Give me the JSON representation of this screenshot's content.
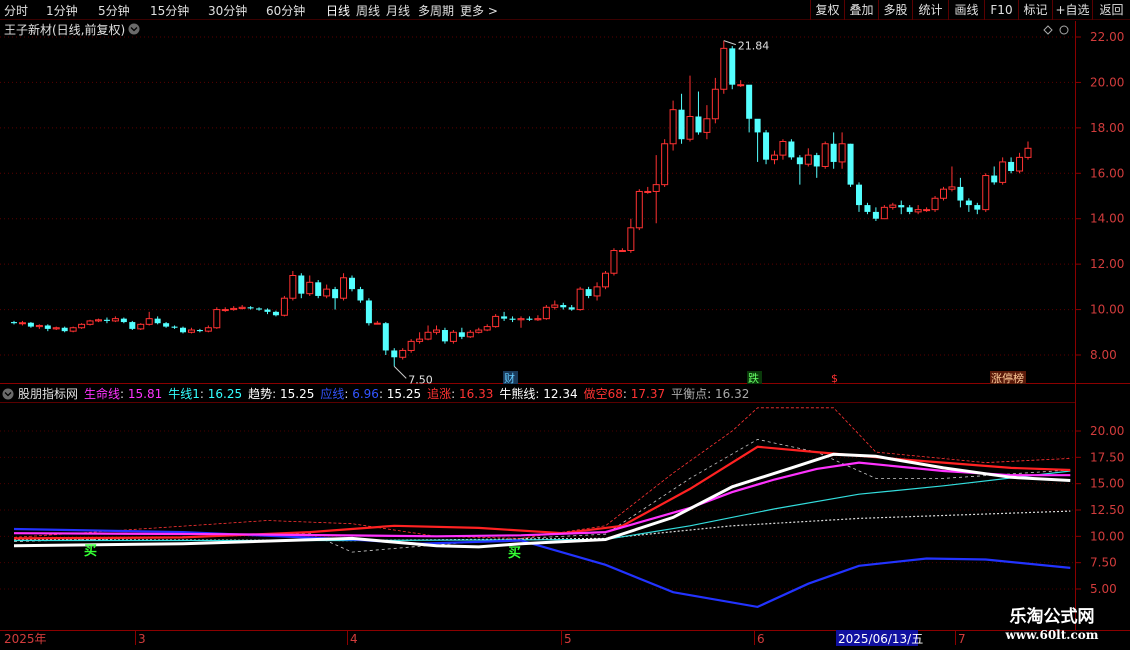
{
  "toolbar": {
    "periods": [
      "分时",
      "1分钟",
      "5分钟",
      "15分钟",
      "30分钟",
      "60分钟",
      "日线",
      "周线",
      "月线",
      "多周期",
      "更多"
    ],
    "active_period": "日线",
    "right_buttons": [
      "复权",
      "叠加",
      "多股",
      "统计",
      "画线",
      "F10",
      "+自选",
      "返回"
    ]
  },
  "main_panel": {
    "title": "王子新材(日线,前复权)",
    "high_label": "21.84",
    "low_label": "7.50",
    "price_axis": [
      "22.00",
      "20.00",
      "18.00",
      "16.00",
      "14.00",
      "12.00",
      "10.00",
      "8.00"
    ],
    "markers": {
      "cai": "财",
      "die": "跌",
      "dollar": "$",
      "bang": "涨停榜"
    }
  },
  "indicator_panel": {
    "name": "股朋指标网",
    "items": [
      {
        "label": "生命线",
        "value": "15.81",
        "color": "#ff33ff"
      },
      {
        "label": "牛线1",
        "value": "16.25",
        "color": "#33ffff"
      },
      {
        "label": "趋势",
        "value": "15.25",
        "color": "#ffffff"
      },
      {
        "label": "应线",
        "value": "6.96",
        "color": "#3355ff"
      },
      {
        "label": "",
        "value": "15.25",
        "color": "#ffffff"
      },
      {
        "label": "追涨",
        "value": "16.33",
        "color": "#ff3333"
      },
      {
        "label": "牛熊线",
        "value": "12.34",
        "color": "#ffffff"
      },
      {
        "label": "做空68",
        "value": "17.37",
        "color": "#ff3333"
      },
      {
        "label": "平衡点",
        "value": "16.32",
        "color": "#aaaaaa"
      }
    ],
    "axis": [
      "20.00",
      "17.50",
      "15.00",
      "12.50",
      "10.00",
      "7.50",
      "5.00"
    ],
    "signal_glyph": "买"
  },
  "time_axis": {
    "labels": [
      "2025年",
      "3",
      "4",
      "5",
      "6",
      "7"
    ],
    "cursor_date": "2025/06/13/五"
  },
  "watermark": {
    "title": "乐淘公式网",
    "url": "www.60lt.com"
  },
  "colors": {
    "up": "#ff3232",
    "down": "#54ffff",
    "grid": "#8b0000",
    "axis_text": "#d23c3c"
  },
  "chart_data": {
    "type": "candlestick",
    "y_range": [
      7.0,
      22.5
    ],
    "candles": [
      [
        9.45,
        9.4,
        9.5,
        9.35
      ],
      [
        9.4,
        9.42,
        9.5,
        9.3
      ],
      [
        9.42,
        9.25,
        9.45,
        9.2
      ],
      [
        9.25,
        9.3,
        9.35,
        9.15
      ],
      [
        9.3,
        9.15,
        9.35,
        9.05
      ],
      [
        9.15,
        9.2,
        9.25,
        9.1
      ],
      [
        9.2,
        9.05,
        9.25,
        9.0
      ],
      [
        9.05,
        9.2,
        9.25,
        9.0
      ],
      [
        9.2,
        9.35,
        9.4,
        9.15
      ],
      [
        9.35,
        9.5,
        9.55,
        9.3
      ],
      [
        9.5,
        9.55,
        9.6,
        9.45
      ],
      [
        9.55,
        9.5,
        9.65,
        9.4
      ],
      [
        9.5,
        9.6,
        9.7,
        9.45
      ],
      [
        9.6,
        9.45,
        9.65,
        9.4
      ],
      [
        9.45,
        9.15,
        9.5,
        9.1
      ],
      [
        9.15,
        9.35,
        9.4,
        9.1
      ],
      [
        9.35,
        9.6,
        9.9,
        9.3
      ],
      [
        9.6,
        9.4,
        9.7,
        9.35
      ],
      [
        9.4,
        9.25,
        9.45,
        9.2
      ],
      [
        9.25,
        9.2,
        9.3,
        9.15
      ],
      [
        9.2,
        9.0,
        9.25,
        8.95
      ],
      [
        9.0,
        9.1,
        9.2,
        8.95
      ],
      [
        9.1,
        9.05,
        9.15,
        9.0
      ],
      [
        9.05,
        9.2,
        9.3,
        9.0
      ],
      [
        9.2,
        10.0,
        10.1,
        9.15
      ],
      [
        10.0,
        10.0,
        10.1,
        9.9
      ],
      [
        10.0,
        10.05,
        10.15,
        9.95
      ],
      [
        10.05,
        10.1,
        10.2,
        10.0
      ],
      [
        10.1,
        10.05,
        10.15,
        10.0
      ],
      [
        10.05,
        10.0,
        10.1,
        9.95
      ],
      [
        10.0,
        9.9,
        10.05,
        9.8
      ],
      [
        9.9,
        9.75,
        9.95,
        9.7
      ],
      [
        9.75,
        10.5,
        10.6,
        9.7
      ],
      [
        10.5,
        11.5,
        11.7,
        10.4
      ],
      [
        11.5,
        10.7,
        11.6,
        10.5
      ],
      [
        10.7,
        11.2,
        11.5,
        10.6
      ],
      [
        11.2,
        10.6,
        11.3,
        10.5
      ],
      [
        10.6,
        10.9,
        11.1,
        10.5
      ],
      [
        10.9,
        10.5,
        11.0,
        10.0
      ],
      [
        10.5,
        11.4,
        11.6,
        10.4
      ],
      [
        11.4,
        10.9,
        11.5,
        10.8
      ],
      [
        10.9,
        10.4,
        11.0,
        10.3
      ],
      [
        10.4,
        9.4,
        10.5,
        9.3
      ],
      [
        9.4,
        9.4,
        9.5,
        9.35
      ],
      [
        9.4,
        8.2,
        9.45,
        8.0
      ],
      [
        8.2,
        7.9,
        8.3,
        7.5
      ],
      [
        7.9,
        8.2,
        8.3,
        7.8
      ],
      [
        8.2,
        8.6,
        8.7,
        8.1
      ],
      [
        8.6,
        8.7,
        9.0,
        8.5
      ],
      [
        8.7,
        9.0,
        9.3,
        8.65
      ],
      [
        9.0,
        9.1,
        9.3,
        8.9
      ],
      [
        9.1,
        8.6,
        9.2,
        8.5
      ],
      [
        8.6,
        9.0,
        9.1,
        8.5
      ],
      [
        9.0,
        8.8,
        9.2,
        8.7
      ],
      [
        8.8,
        9.0,
        9.1,
        8.75
      ],
      [
        9.0,
        9.1,
        9.2,
        8.95
      ],
      [
        9.1,
        9.25,
        9.35,
        9.05
      ],
      [
        9.25,
        9.7,
        9.8,
        9.2
      ],
      [
        9.7,
        9.6,
        9.9,
        9.5
      ],
      [
        9.6,
        9.55,
        9.7,
        9.45
      ],
      [
        9.55,
        9.6,
        9.7,
        9.2
      ],
      [
        9.6,
        9.55,
        9.7,
        9.5
      ],
      [
        9.55,
        9.6,
        9.75,
        9.5
      ],
      [
        9.6,
        10.1,
        10.2,
        9.55
      ],
      [
        10.1,
        10.2,
        10.4,
        10.0
      ],
      [
        10.2,
        10.1,
        10.3,
        10.0
      ],
      [
        10.1,
        10.0,
        10.2,
        9.95
      ],
      [
        10.0,
        10.9,
        11.0,
        9.95
      ],
      [
        10.9,
        10.6,
        11.0,
        10.5
      ],
      [
        10.6,
        11.0,
        11.2,
        10.4
      ],
      [
        11.0,
        11.6,
        11.7,
        10.9
      ],
      [
        11.6,
        12.6,
        12.7,
        11.5
      ],
      [
        12.6,
        12.6,
        12.7,
        12.55
      ],
      [
        12.6,
        13.6,
        14.0,
        12.5
      ],
      [
        13.6,
        15.2,
        15.3,
        13.5
      ],
      [
        15.2,
        15.2,
        15.4,
        15.1
      ],
      [
        15.2,
        15.5,
        16.8,
        13.8
      ],
      [
        15.5,
        17.3,
        17.5,
        15.4
      ],
      [
        17.3,
        18.8,
        19.2,
        17.0
      ],
      [
        18.8,
        17.5,
        19.5,
        17.3
      ],
      [
        17.5,
        18.5,
        20.3,
        17.4
      ],
      [
        18.5,
        17.8,
        19.6,
        17.7
      ],
      [
        17.8,
        18.4,
        19.0,
        17.5
      ],
      [
        18.4,
        19.7,
        20.2,
        18.2
      ],
      [
        19.7,
        21.5,
        21.84,
        19.5
      ],
      [
        21.5,
        19.9,
        21.6,
        19.7
      ],
      [
        19.9,
        19.9,
        20.1,
        19.8
      ],
      [
        19.9,
        18.4,
        18.7,
        17.8
      ],
      [
        18.4,
        17.8,
        18.1,
        16.5
      ],
      [
        17.8,
        16.6,
        17.9,
        16.4
      ],
      [
        16.6,
        16.8,
        17.0,
        16.4
      ],
      [
        16.8,
        17.4,
        17.5,
        16.6
      ],
      [
        17.4,
        16.7,
        17.5,
        16.6
      ],
      [
        16.7,
        16.4,
        16.8,
        15.5
      ],
      [
        16.4,
        16.8,
        17.1,
        16.3
      ],
      [
        16.8,
        16.3,
        16.9,
        15.8
      ],
      [
        16.3,
        17.3,
        17.4,
        16.2
      ],
      [
        17.3,
        16.5,
        17.8,
        16.2
      ],
      [
        16.5,
        17.3,
        17.8,
        16.2
      ],
      [
        17.3,
        15.5,
        17.3,
        15.4
      ],
      [
        15.5,
        14.6,
        15.6,
        14.3
      ],
      [
        14.6,
        14.3,
        14.7,
        14.2
      ],
      [
        14.3,
        14.0,
        14.5,
        13.9
      ],
      [
        14.0,
        14.5,
        14.6,
        14.0
      ],
      [
        14.5,
        14.6,
        14.7,
        14.4
      ],
      [
        14.6,
        14.5,
        14.8,
        14.2
      ],
      [
        14.5,
        14.3,
        14.6,
        14.2
      ],
      [
        14.3,
        14.4,
        14.6,
        14.2
      ],
      [
        14.4,
        14.4,
        14.5,
        14.3
      ],
      [
        14.4,
        14.9,
        15.0,
        14.3
      ],
      [
        14.9,
        15.3,
        15.4,
        14.8
      ],
      [
        15.3,
        15.4,
        16.3,
        15.2
      ],
      [
        15.4,
        14.8,
        15.8,
        14.5
      ],
      [
        14.8,
        14.6,
        14.9,
        14.3
      ],
      [
        14.6,
        14.4,
        14.7,
        14.2
      ],
      [
        14.4,
        15.9,
        16.0,
        14.3
      ],
      [
        15.9,
        15.6,
        16.3,
        15.5
      ],
      [
        15.6,
        16.5,
        16.7,
        15.5
      ],
      [
        16.5,
        16.1,
        16.7,
        16.0
      ],
      [
        16.1,
        16.7,
        16.9,
        16.0
      ],
      [
        16.7,
        17.1,
        17.4,
        16.6
      ]
    ],
    "indicator_range": [
      4.5,
      22.5
    ],
    "indicator_series": {
      "life_line_magenta": [
        [
          0,
          10.3
        ],
        [
          25,
          10.2
        ],
        [
          50,
          10.0
        ],
        [
          60,
          10.1
        ],
        [
          70,
          10.4
        ],
        [
          80,
          12.7
        ],
        [
          85,
          14.2
        ],
        [
          90,
          15.4
        ],
        [
          95,
          16.4
        ],
        [
          100,
          17.0
        ],
        [
          110,
          16.2
        ],
        [
          118,
          15.8
        ],
        [
          125,
          15.8
        ]
      ],
      "bull_line_cyan": [
        [
          0,
          9.6
        ],
        [
          40,
          9.6
        ],
        [
          70,
          9.7
        ],
        [
          80,
          11.0
        ],
        [
          90,
          12.6
        ],
        [
          100,
          14.0
        ],
        [
          110,
          14.8
        ],
        [
          125,
          16.2
        ]
      ],
      "trend_white": [
        [
          0,
          9.1
        ],
        [
          20,
          9.3
        ],
        [
          40,
          9.8
        ],
        [
          50,
          9.1
        ],
        [
          55,
          9.0
        ],
        [
          60,
          9.3
        ],
        [
          70,
          9.7
        ],
        [
          78,
          11.8
        ],
        [
          85,
          14.7
        ],
        [
          92,
          16.5
        ],
        [
          97,
          17.8
        ],
        [
          102,
          17.6
        ],
        [
          110,
          16.5
        ],
        [
          118,
          15.6
        ],
        [
          125,
          15.3
        ]
      ],
      "answer_blue": [
        [
          0,
          10.7
        ],
        [
          20,
          10.4
        ],
        [
          40,
          9.7
        ],
        [
          48,
          9.3
        ],
        [
          60,
          9.6
        ],
        [
          70,
          7.3
        ],
        [
          78,
          4.7
        ],
        [
          88,
          3.3
        ],
        [
          94,
          5.5
        ],
        [
          100,
          7.2
        ],
        [
          108,
          7.9
        ],
        [
          115,
          7.8
        ],
        [
          125,
          7.0
        ]
      ],
      "chase_red": [
        [
          0,
          9.8
        ],
        [
          20,
          9.9
        ],
        [
          35,
          10.4
        ],
        [
          45,
          11.0
        ],
        [
          55,
          10.8
        ],
        [
          65,
          10.3
        ],
        [
          72,
          11.0
        ],
        [
          80,
          14.5
        ],
        [
          88,
          18.5
        ],
        [
          95,
          18.0
        ],
        [
          105,
          17.3
        ],
        [
          118,
          16.5
        ],
        [
          125,
          16.3
        ]
      ],
      "bull_bear_white_dotted": [
        [
          0,
          9.7
        ],
        [
          40,
          9.6
        ],
        [
          70,
          9.8
        ],
        [
          85,
          11.0
        ],
        [
          100,
          11.7
        ],
        [
          125,
          12.4
        ]
      ],
      "short68_red_dotted": [
        [
          0,
          9.9
        ],
        [
          30,
          11.5
        ],
        [
          40,
          11.2
        ],
        [
          50,
          10.0
        ],
        [
          60,
          9.8
        ],
        [
          70,
          11.0
        ],
        [
          78,
          16.0
        ],
        [
          85,
          20.0
        ],
        [
          88,
          22.2
        ],
        [
          97,
          22.2
        ],
        [
          102,
          18.0
        ],
        [
          115,
          17.0
        ],
        [
          125,
          17.4
        ]
      ],
      "balance_white_dotted": [
        [
          0,
          9.5
        ],
        [
          35,
          10.3
        ],
        [
          40,
          8.5
        ],
        [
          50,
          9.2
        ],
        [
          60,
          9.8
        ],
        [
          70,
          10.2
        ],
        [
          80,
          15.5
        ],
        [
          88,
          19.2
        ],
        [
          95,
          18.0
        ],
        [
          102,
          15.5
        ],
        [
          110,
          15.5
        ],
        [
          125,
          16.3
        ]
      ]
    }
  }
}
